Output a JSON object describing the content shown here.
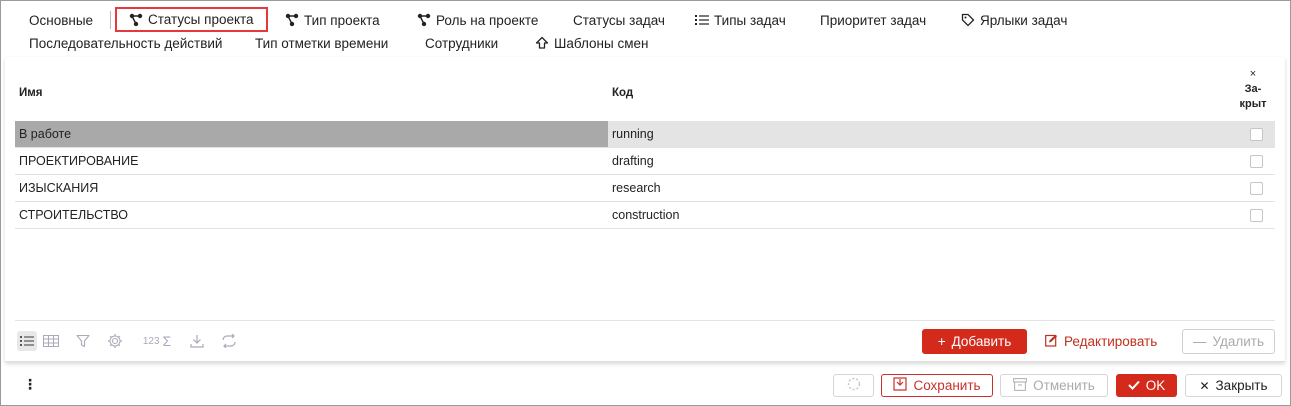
{
  "tabs": {
    "row1": [
      {
        "label": "Основные",
        "icon": ""
      },
      {
        "label": "Статусы проекта",
        "icon": "hierarchy-icon"
      },
      {
        "label": "Тип проекта",
        "icon": "hierarchy-icon"
      },
      {
        "label": "Роль на проекте",
        "icon": "hierarchy-icon"
      },
      {
        "label": "Статусы задач",
        "icon": ""
      },
      {
        "label": "Типы задач",
        "icon": "list-icon"
      },
      {
        "label": "Приоритет задач",
        "icon": ""
      },
      {
        "label": "Ярлыки задач",
        "icon": "tag-icon"
      }
    ],
    "row2": [
      {
        "label": "Последовательность действий",
        "icon": ""
      },
      {
        "label": "Тип отметки времени",
        "icon": ""
      },
      {
        "label": "Сотрудники",
        "icon": ""
      },
      {
        "label": "Шаблоны смен",
        "icon": "upload-arrow-icon"
      }
    ]
  },
  "grid": {
    "col_name": "Имя",
    "col_code": "Код",
    "col_closed_x": "×",
    "col_closed_l1": "За-",
    "col_closed_l2": "крыт",
    "rows": [
      {
        "name": "В работе",
        "code": "running",
        "closed": false
      },
      {
        "name": "ПРОЕКТИРОВАНИЕ",
        "code": "drafting",
        "closed": false
      },
      {
        "name": "ИЗЫСКАНИЯ",
        "code": "research",
        "closed": false
      },
      {
        "name": "СТРОИТЕЛЬСТВО",
        "code": "construction",
        "closed": false
      }
    ]
  },
  "toolbar": {
    "sum_label": "123",
    "add_label": "Добавить",
    "edit_label": "Редактировать",
    "delete_label": "Удалить"
  },
  "footer": {
    "save_label": "Сохранить",
    "cancel_label": "Отменить",
    "ok_label": "OK",
    "close_label": "Закрыть"
  },
  "colors": {
    "accent": "#d42a1c",
    "active_tab_border": "#e5393b",
    "selected_row_name": "#a9a9a9",
    "selected_row_code": "#e4e4e4"
  }
}
